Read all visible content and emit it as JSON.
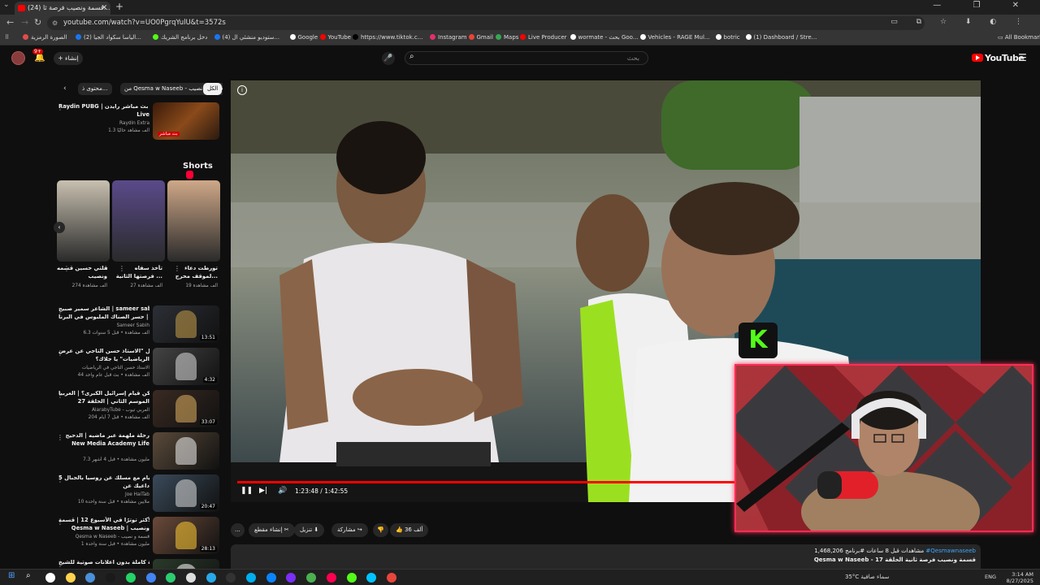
{
  "browser": {
    "tab_title": "(24) قسمة ونصيب فرصة ثا...",
    "url": "youtube.com/watch?v=UO0PgrqYulU&t=3572s",
    "bookmarks": [
      {
        "label": "الصورة الرمزية",
        "color": "#e24b4b"
      },
      {
        "label": "(2) الياسا سكواد الجيا...",
        "color": "#1877f2"
      },
      {
        "label": "دخل برنامج الشريك",
        "color": "#53fc18"
      },
      {
        "label": "(4) ستوديو منشئي ال...",
        "color": "#1877f2"
      },
      {
        "label": "Google",
        "color": "#ffffff"
      },
      {
        "label": "YouTube",
        "color": "#ff0000"
      },
      {
        "label": "https://www.tiktok.c...",
        "color": "#000000"
      },
      {
        "label": "Instagram",
        "color": "#e1306c"
      },
      {
        "label": "Gmail",
        "color": "#ea4335"
      },
      {
        "label": "Maps",
        "color": "#34a853"
      },
      {
        "label": "Live Producer",
        "color": "#ff0000"
      },
      {
        "label": "wormate - بحث Goo...",
        "color": "#ffffff"
      },
      {
        "label": "Vehicles - RAGE Mul...",
        "color": "#ffffff"
      },
      {
        "label": "botric",
        "color": "#ffffff"
      },
      {
        "label": "(1) Dashboard / Stre...",
        "color": "#ffffff"
      }
    ],
    "all_bookmarks": "All Bookmarks"
  },
  "header": {
    "logo_text": "YouTube",
    "search_placeholder": "بحث",
    "create_label": "إنشاء",
    "notif_count": "9+"
  },
  "sidebar": {
    "chips": [
      {
        "label": "الكل",
        "selected": true
      },
      {
        "label": "من Qesma w Naseeb - قسمة و نصيب",
        "selected": false
      },
      {
        "label": "محتوى ذ...",
        "selected": false
      }
    ],
    "live_item": {
      "title": "Raydin PUBG | بث مباشر رايدن ⚡",
      "title2": "Live",
      "channel": "Raydin Extra",
      "meta": "1.3 ألف مشاهد حاليًا",
      "badge": "بث مباشر"
    },
    "shorts_title": "Shorts",
    "shorts": [
      {
        "title1": "مقلتي حسين قسمه",
        "title2": "ونصيب",
        "views": "274 ألف مشاهدة"
      },
      {
        "title1": "تأخذ سفاه",
        "title2": "فرصتها الثانية ...",
        "views": "27 ألف مشاهدة"
      },
      {
        "title1": "تورطت دعاء",
        "title2": "لموقف محرج...",
        "views": "19 ألف مشاهدة"
      }
    ],
    "videos": [
      {
        "title1": "الشاعر سمير صبيح | sameer sabih",
        "title2": "جل وأبل | حسر الصناك الملبوس في البرنا...",
        "channel": "Sameer Sabih",
        "meta": "6.3 ألف مشاهدة • قبل 5 سنوات",
        "duration": "13:51",
        "thumb": "#2c2f36",
        "accent": "#c9a14a"
      },
      {
        "title1": "بماذا قال \"الاستاذ حسن التاجي عن عرض",
        "title2": "الرياضيات\" يا جلاك؟",
        "channel": "الاستاذ حسن التاجي في الرياضيات",
        "meta": "44 ألف مشاهدة • بث قبل عام واحد",
        "duration": "4:32",
        "thumb": "#444444",
        "accent": "#dddddd"
      },
      {
        "title1": "هل يمكن قيام إسرائيل الكبرى؟ | العربيا |",
        "title2": "الموسم الثاني | الحلقة 27",
        "channel": "AlarabyTube - العربي تيوب",
        "meta": "204 ألف مشاهدة • قبل 7 أيام",
        "duration": "33:07",
        "thumb": "#3a2a22",
        "accent": "#e0b060"
      },
      {
        "title1": "رحلة ملهمة عبر ماضيه | الدحيح",
        "title2": "New Media Academy Life",
        "channel": "",
        "meta": "7.3 مليون مشاهدة • قبل 4 أشهر",
        "duration": "",
        "thumb": "#5a4a3a",
        "accent": "#f0f0f0"
      },
      {
        "title1": "5 أيام مع مسلك عن روسيا بالجبال -",
        "title2": "داعيك عن",
        "channel": "Joe HaiTab",
        "meta": "10 ملايين مشاهدة • قبل سنة واحدة",
        "duration": "20:47",
        "thumb": "#3a4a5a",
        "accent": "#dddddd"
      },
      {
        "title1": "اللحظات الأكثر توترًا في الأسبوع 12 | قسمة",
        "title2": "Qesma w Naseeb | ونصيب",
        "channel": "Qesma w Naseeb - قسمة و نصيب",
        "meta": "1 مليون مشاهدة • قبل سنة واحدة",
        "duration": "28:13",
        "thumb": "#6a4a3a",
        "accent": "#ffcc33"
      },
      {
        "title1": "سورة البقرة كاملة بدون اعلانات صوتية للشيخ",
        "title2": "",
        "channel": "",
        "meta": "",
        "duration": "",
        "thumb": "#2a3a2a",
        "accent": "#ffffff"
      }
    ]
  },
  "player": {
    "time_current": "1:23:48",
    "time_total": "1:42:55",
    "progress": 0.8143,
    "overlay_label": "K"
  },
  "actions": {
    "likes": "36 ألف",
    "share": "مشاركة",
    "download": "تنزيل",
    "clip": "إنشاء مقطع",
    "more": "..."
  },
  "description": {
    "stats": "1,468,206 مشاهدات قبل 8 ساعات #برنامج",
    "hashtag": "#Qesmawnaseeb",
    "title": "Qesma w Naseeb - قسمة ونصيب فرصة ثانية الحلقة 17"
  },
  "taskbar": {
    "weather": "35°C سماء صافية",
    "lang": "ENG",
    "time": "3:14 AM",
    "date": "8/27/2025",
    "icons": [
      "#ffffff",
      "#ffd34d",
      "#4a90d9",
      "#1a1a1a",
      "#25d366",
      "#4285f4",
      "#2ecc71",
      "#dddddd",
      "#29a9eb",
      "#333333",
      "#00aff0",
      "#0a84ff",
      "#7b2ff7",
      "#4caf50",
      "#ff0050",
      "#53fc18",
      "#00c4ff",
      "#e8453c"
    ]
  }
}
